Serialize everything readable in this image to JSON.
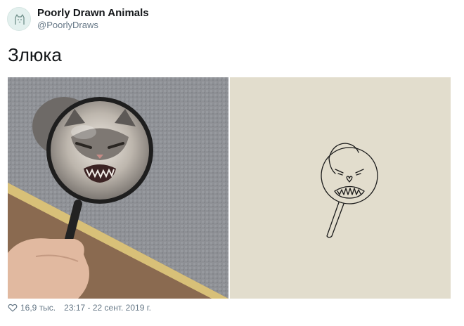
{
  "author": {
    "display_name": "Poorly Drawn Animals",
    "handle": "@PoorlyDraws",
    "avatar_icon": "cat-doodle-icon"
  },
  "tweet": {
    "text": "Злюка"
  },
  "media": {
    "left_image": "photo of an angry cat magnified through a magnifying glass held by a hand",
    "right_image": "simple line drawing of an angry creature on a lollipop stick"
  },
  "footer": {
    "like_icon": "heart-icon",
    "likes": "16,9 тыс.",
    "timestamp": "23:17 - 22 сент. 2019 г."
  },
  "colors": {
    "name": "#14171a",
    "secondary": "#657786",
    "drawing_bg": "#e2ddcd"
  }
}
